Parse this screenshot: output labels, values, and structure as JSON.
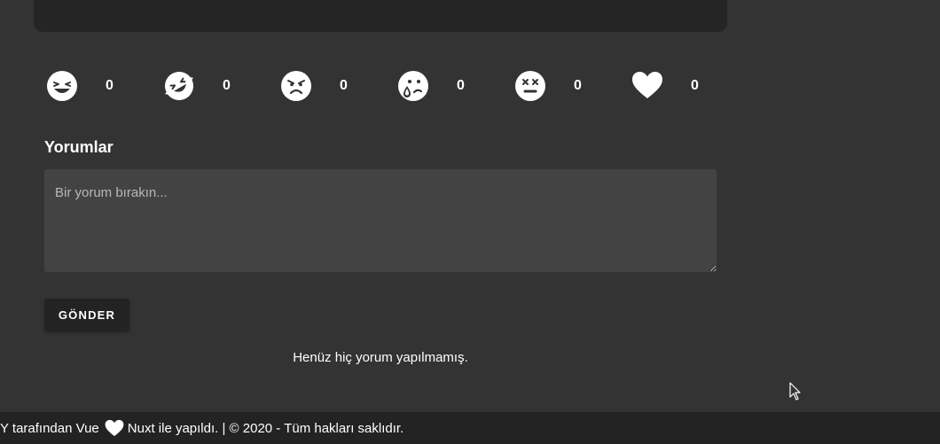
{
  "reactions": [
    {
      "icon": "grin-squint-icon",
      "count": "0"
    },
    {
      "icon": "grin-squint-tears-icon",
      "count": "0"
    },
    {
      "icon": "angry-face-icon",
      "count": "0"
    },
    {
      "icon": "sad-tear-icon",
      "count": "0"
    },
    {
      "icon": "dizzy-face-icon",
      "count": "0"
    },
    {
      "icon": "heart-icon",
      "count": "0"
    }
  ],
  "comments": {
    "title": "Yorumlar",
    "placeholder": "Bir yorum bırakın...",
    "value": "",
    "submit_label": "GÖNDER",
    "empty_message": "Henüz hiç yorum yapılmamış."
  },
  "footer": {
    "text_before": "Y tarafından Vue",
    "heart_icon": "heart-icon",
    "text_after": "Nuxt ile yapıldı. | © 2020 - Tüm hakları saklıdır."
  },
  "colors": {
    "background": "#333333",
    "card": "#252525",
    "input": "#434343",
    "button": "#232323",
    "footer": "#232323",
    "text": "#ffffff"
  }
}
